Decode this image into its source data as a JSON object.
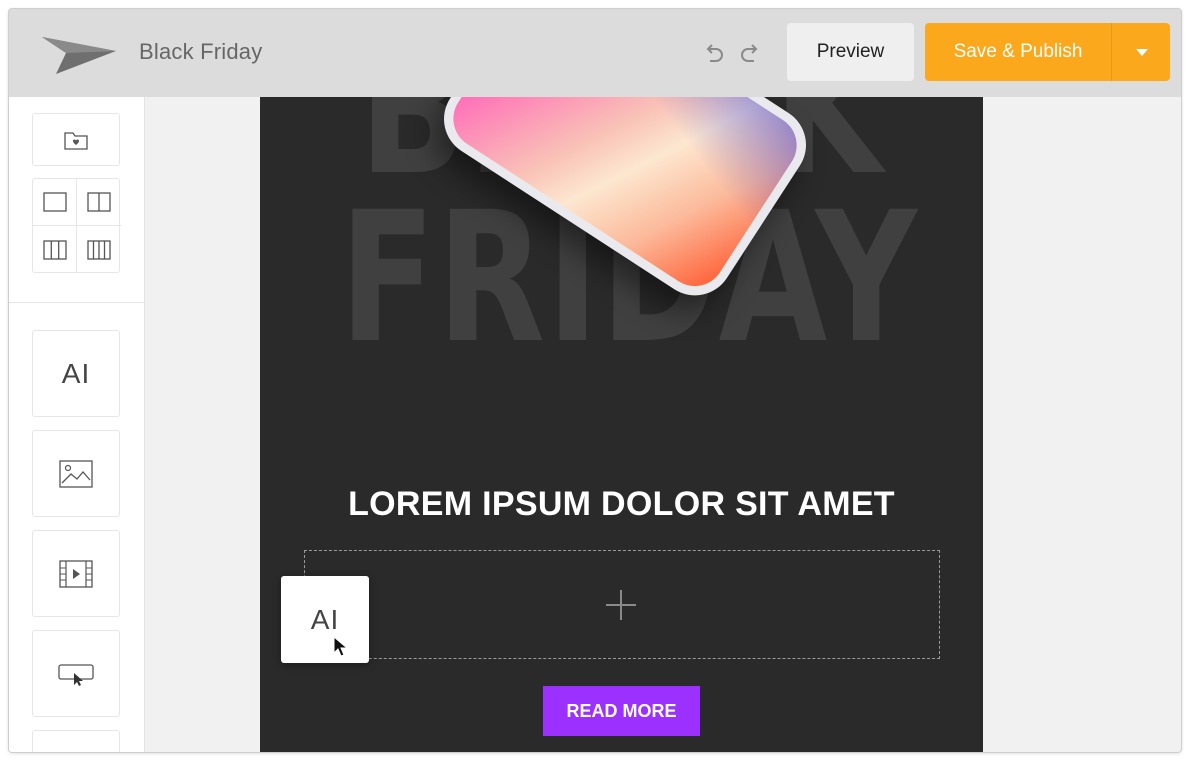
{
  "app": {
    "document_title": "Black Friday"
  },
  "toolbar": {
    "undo_icon": "undo-icon",
    "redo_icon": "redo-icon",
    "preview_label": "Preview",
    "publish_label": "Save & Publish",
    "publish_dropdown_icon": "caret-down-icon",
    "accent_color": "#fba81c"
  },
  "sidebar": {
    "sections": [
      {
        "icon": "folder-heart-icon"
      },
      {
        "layouts": [
          "one-column-icon",
          "two-column-icon",
          "three-column-icon",
          "four-column-icon"
        ]
      }
    ],
    "blocks": [
      {
        "icon": "text-block-icon",
        "label": "AI"
      },
      {
        "icon": "image-block-icon"
      },
      {
        "icon": "video-block-icon"
      },
      {
        "icon": "button-block-icon"
      }
    ]
  },
  "email": {
    "background_text": "BLACK FRIDAY",
    "headline": "LOREM IPSUM DOLOR SIT AMET",
    "dropzone_icon": "plus-icon",
    "cta_label": "READ MORE",
    "cta_color": "#9b30ff",
    "background_color": "#2a2a2a"
  },
  "drag": {
    "label": "AI",
    "icon": "text-block-icon"
  }
}
